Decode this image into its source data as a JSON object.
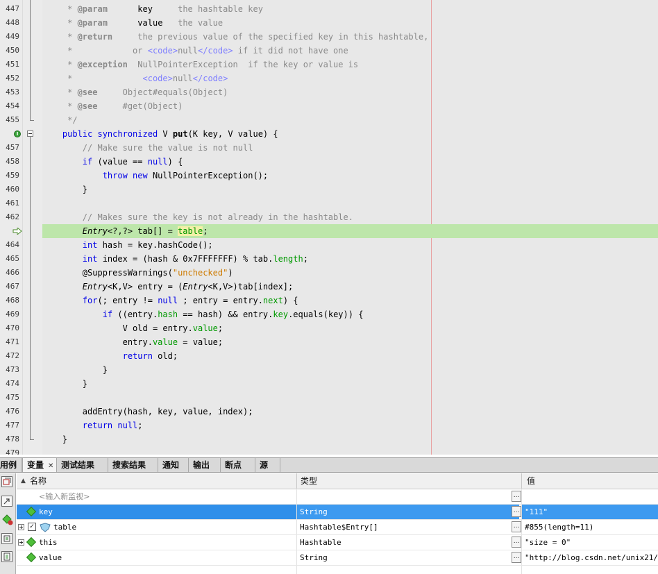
{
  "editor": {
    "lines": [
      {
        "num": "447",
        "tokens": [
          {
            "t": "     * ",
            "c": "cm"
          },
          {
            "t": "@param",
            "c": "cm bd"
          },
          {
            "t": "      ",
            "c": "cm"
          },
          {
            "t": "key",
            "c": ""
          },
          {
            "t": "     the hashtable key",
            "c": "cm"
          }
        ]
      },
      {
        "num": "448",
        "tokens": [
          {
            "t": "     * ",
            "c": "cm"
          },
          {
            "t": "@param",
            "c": "cm bd"
          },
          {
            "t": "      ",
            "c": "cm"
          },
          {
            "t": "value",
            "c": ""
          },
          {
            "t": "   the value",
            "c": "cm"
          }
        ]
      },
      {
        "num": "449",
        "tokens": [
          {
            "t": "     * ",
            "c": "cm"
          },
          {
            "t": "@return",
            "c": "cm bd"
          },
          {
            "t": "     the previous value of the specified key in this hashtable,",
            "c": "cm"
          }
        ]
      },
      {
        "num": "450",
        "tokens": [
          {
            "t": "     *            or ",
            "c": "cm"
          },
          {
            "t": "<code>",
            "c": "tg"
          },
          {
            "t": "null",
            "c": "cm"
          },
          {
            "t": "</code>",
            "c": "tg"
          },
          {
            "t": " if it did not have one",
            "c": "cm"
          }
        ]
      },
      {
        "num": "451",
        "tokens": [
          {
            "t": "     * ",
            "c": "cm"
          },
          {
            "t": "@exception",
            "c": "cm bd"
          },
          {
            "t": "  NullPointerException  if the key or value is",
            "c": "cm"
          }
        ]
      },
      {
        "num": "452",
        "tokens": [
          {
            "t": "     *              ",
            "c": "cm"
          },
          {
            "t": "<code>",
            "c": "tg"
          },
          {
            "t": "null",
            "c": "cm"
          },
          {
            "t": "</code>",
            "c": "tg"
          }
        ]
      },
      {
        "num": "453",
        "tokens": [
          {
            "t": "     * ",
            "c": "cm"
          },
          {
            "t": "@see",
            "c": "cm bd"
          },
          {
            "t": "     Object#equals(Object)",
            "c": "cm"
          }
        ]
      },
      {
        "num": "454",
        "tokens": [
          {
            "t": "     * ",
            "c": "cm"
          },
          {
            "t": "@see",
            "c": "cm bd"
          },
          {
            "t": "     #get(Object)",
            "c": "cm"
          }
        ]
      },
      {
        "num": "455",
        "tokens": [
          {
            "t": "     */",
            "c": "cm"
          }
        ]
      },
      {
        "num": "",
        "marker": "implements",
        "tokens": [
          {
            "t": "    ",
            "c": ""
          },
          {
            "t": "public synchronized",
            "c": "kw"
          },
          {
            "t": " V ",
            "c": ""
          },
          {
            "t": "put",
            "c": "bd"
          },
          {
            "t": "(K key, V value) {",
            "c": ""
          }
        ]
      },
      {
        "num": "457",
        "tokens": [
          {
            "t": "        // Make sure the value is not null",
            "c": "cm"
          }
        ]
      },
      {
        "num": "458",
        "tokens": [
          {
            "t": "        ",
            "c": ""
          },
          {
            "t": "if",
            "c": "kw"
          },
          {
            "t": " (value == ",
            "c": ""
          },
          {
            "t": "null",
            "c": "kw"
          },
          {
            "t": ") {",
            "c": ""
          }
        ]
      },
      {
        "num": "459",
        "tokens": [
          {
            "t": "            ",
            "c": ""
          },
          {
            "t": "throw new",
            "c": "kw"
          },
          {
            "t": " NullPointerException();",
            "c": ""
          }
        ]
      },
      {
        "num": "460",
        "tokens": [
          {
            "t": "        }",
            "c": ""
          }
        ]
      },
      {
        "num": "461",
        "tokens": [
          {
            "t": "",
            "c": ""
          }
        ]
      },
      {
        "num": "462",
        "tokens": [
          {
            "t": "        // Makes sure the key is not already in the hashtable.",
            "c": "cm"
          }
        ]
      },
      {
        "num": "",
        "marker": "current",
        "tokens": [
          {
            "t": "        ",
            "c": ""
          },
          {
            "t": "Entry",
            "c": "it"
          },
          {
            "t": "<?,?> tab[] = ",
            "c": ""
          },
          {
            "t": "table",
            "c": "fd hl"
          },
          {
            "t": ";",
            "c": ""
          }
        ]
      },
      {
        "num": "464",
        "tokens": [
          {
            "t": "        ",
            "c": ""
          },
          {
            "t": "int",
            "c": "kw"
          },
          {
            "t": " hash = key.hashCode();",
            "c": ""
          }
        ]
      },
      {
        "num": "465",
        "tokens": [
          {
            "t": "        ",
            "c": ""
          },
          {
            "t": "int",
            "c": "kw"
          },
          {
            "t": " index = (hash & 0x7FFFFFFF) % tab.",
            "c": ""
          },
          {
            "t": "length",
            "c": "fd"
          },
          {
            "t": ";",
            "c": ""
          }
        ]
      },
      {
        "num": "466",
        "tokens": [
          {
            "t": "        @SuppressWarnings(",
            "c": ""
          },
          {
            "t": "\"unchecked\"",
            "c": "str"
          },
          {
            "t": ")",
            "c": ""
          }
        ]
      },
      {
        "num": "467",
        "tokens": [
          {
            "t": "        ",
            "c": ""
          },
          {
            "t": "Entry",
            "c": "it"
          },
          {
            "t": "<K,V> entry = (",
            "c": ""
          },
          {
            "t": "Entry",
            "c": "it"
          },
          {
            "t": "<K,V>)tab[index];",
            "c": ""
          }
        ]
      },
      {
        "num": "468",
        "tokens": [
          {
            "t": "        ",
            "c": ""
          },
          {
            "t": "for",
            "c": "kw"
          },
          {
            "t": "(; entry != ",
            "c": ""
          },
          {
            "t": "null",
            "c": "kw"
          },
          {
            "t": " ; entry = entry.",
            "c": ""
          },
          {
            "t": "next",
            "c": "fd"
          },
          {
            "t": ") {",
            "c": ""
          }
        ]
      },
      {
        "num": "469",
        "tokens": [
          {
            "t": "            ",
            "c": ""
          },
          {
            "t": "if",
            "c": "kw"
          },
          {
            "t": " ((entry.",
            "c": ""
          },
          {
            "t": "hash",
            "c": "fd"
          },
          {
            "t": " == hash) && entry.",
            "c": ""
          },
          {
            "t": "key",
            "c": "fd"
          },
          {
            "t": ".equals(key)) {",
            "c": ""
          }
        ]
      },
      {
        "num": "470",
        "tokens": [
          {
            "t": "                V old = entry.",
            "c": ""
          },
          {
            "t": "value",
            "c": "fd"
          },
          {
            "t": ";",
            "c": ""
          }
        ]
      },
      {
        "num": "471",
        "tokens": [
          {
            "t": "                entry.",
            "c": ""
          },
          {
            "t": "value",
            "c": "fd"
          },
          {
            "t": " = value;",
            "c": ""
          }
        ]
      },
      {
        "num": "472",
        "tokens": [
          {
            "t": "                ",
            "c": ""
          },
          {
            "t": "return",
            "c": "kw"
          },
          {
            "t": " old;",
            "c": ""
          }
        ]
      },
      {
        "num": "473",
        "tokens": [
          {
            "t": "            }",
            "c": ""
          }
        ]
      },
      {
        "num": "474",
        "tokens": [
          {
            "t": "        }",
            "c": ""
          }
        ]
      },
      {
        "num": "475",
        "tokens": [
          {
            "t": "",
            "c": ""
          }
        ]
      },
      {
        "num": "476",
        "tokens": [
          {
            "t": "        addEntry(hash, key, value, index);",
            "c": ""
          }
        ]
      },
      {
        "num": "477",
        "tokens": [
          {
            "t": "        ",
            "c": ""
          },
          {
            "t": "return null",
            "c": "kw"
          },
          {
            "t": ";",
            "c": ""
          }
        ]
      },
      {
        "num": "478",
        "tokens": [
          {
            "t": "    }",
            "c": ""
          }
        ]
      },
      {
        "num": "479",
        "tokens": [
          {
            "t": "",
            "c": ""
          }
        ]
      }
    ]
  },
  "tabs": [
    {
      "label": "用例",
      "active": false
    },
    {
      "label": "变量",
      "active": true,
      "closable": true
    },
    {
      "label": "测试结果",
      "active": false
    },
    {
      "label": "搜索结果",
      "active": false
    },
    {
      "label": "通知",
      "active": false
    },
    {
      "label": "输出",
      "active": false
    },
    {
      "label": "断点",
      "active": false
    },
    {
      "label": "源",
      "active": false
    }
  ],
  "variables": {
    "columns": {
      "name": "名称",
      "type": "类型",
      "value": "值"
    },
    "new_watch_placeholder": "<输入新监视>",
    "rows": [
      {
        "name": "key",
        "type": "String",
        "value": "\"111\"",
        "selected": true,
        "expandable": false,
        "checkbox": false,
        "icon": "field-diamond-icon"
      },
      {
        "name": "table",
        "type": "Hashtable$Entry[]",
        "value": "#855(length=11)",
        "selected": false,
        "expandable": true,
        "checkbox": true,
        "icon": "field-shield-icon"
      },
      {
        "name": "this",
        "type": "Hashtable",
        "value": "\"size = 0\"",
        "selected": false,
        "expandable": true,
        "checkbox": false,
        "icon": "field-diamond-icon"
      },
      {
        "name": "value",
        "type": "String",
        "value": "\"http://blog.csdn.net/unix21/\"",
        "selected": false,
        "expandable": false,
        "checkbox": false,
        "icon": "field-diamond-icon"
      }
    ],
    "ellipsis_label": "..."
  },
  "colors": {
    "current_line": "#bde6aa",
    "selection": "#3d9af0",
    "keyword": "#0000e6",
    "field": "#009900",
    "comment": "#8a8a8a"
  }
}
